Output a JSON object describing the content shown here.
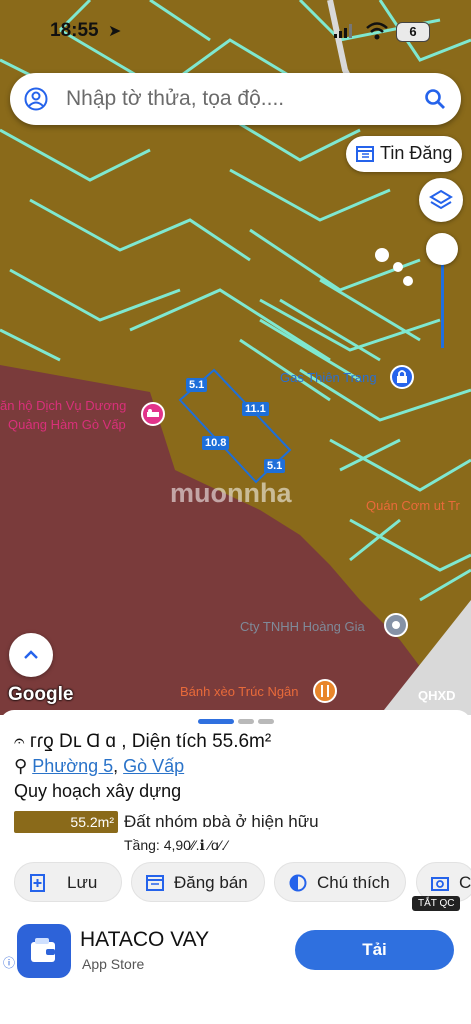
{
  "status_bar": {
    "time": "18:55",
    "battery": "6"
  },
  "search": {
    "placeholder": "Nhập tờ thửa, tọa độ...."
  },
  "map": {
    "tin_dang_label": "Tin Đăng",
    "google_label": "Google",
    "qhxd_label": "QHXD",
    "watermark": "muonnha",
    "pois": [
      {
        "label": "Gas Thiên Trang"
      },
      {
        "label": "ăn hộ Dịch Vụ Dương"
      },
      {
        "label": "Quảng Hàm Gò Vấp"
      },
      {
        "label": "Quán Cơm ut Tr"
      },
      {
        "label": "Cty TNHH Hoàng Gia"
      },
      {
        "label": "Bánh xèo Trúc Ngân"
      }
    ],
    "dimensions": [
      "5.1",
      "11.1",
      "10.8",
      "5.1"
    ],
    "colors": {
      "residential": "#8a6a1a",
      "park_zone": "#7a3b3b",
      "boundary": "#7fe8d0",
      "road": "#d9d9d9"
    }
  },
  "sheet": {
    "title": "𝄐 ᴦɾƍ Dւ Ɑ ɑ , Diện tích 55.6m²",
    "ward": "Phường 5",
    "district": "Gò Vấp",
    "plan_heading": "Quy hoạch xây dựng",
    "area_badge": "55.2m²",
    "land_type": "Đất nhóm ɒbà ở hiện hữu",
    "floors": "Tầng: 4,90⁄⁄.ℹ ⁄ɑ⁄.⁄",
    "actions": [
      {
        "label": "Lưu",
        "icon": "save-plus-icon"
      },
      {
        "label": "Đăng bán",
        "icon": "calendar-icon"
      },
      {
        "label": "Chú thích",
        "icon": "half-circle-icon"
      },
      {
        "label": "C",
        "icon": "camera-plus-icon"
      }
    ],
    "ad_badge": "TẮT QC"
  },
  "ad": {
    "name": "HATACO VAY",
    "store": "App Store",
    "cta": "Tải"
  }
}
